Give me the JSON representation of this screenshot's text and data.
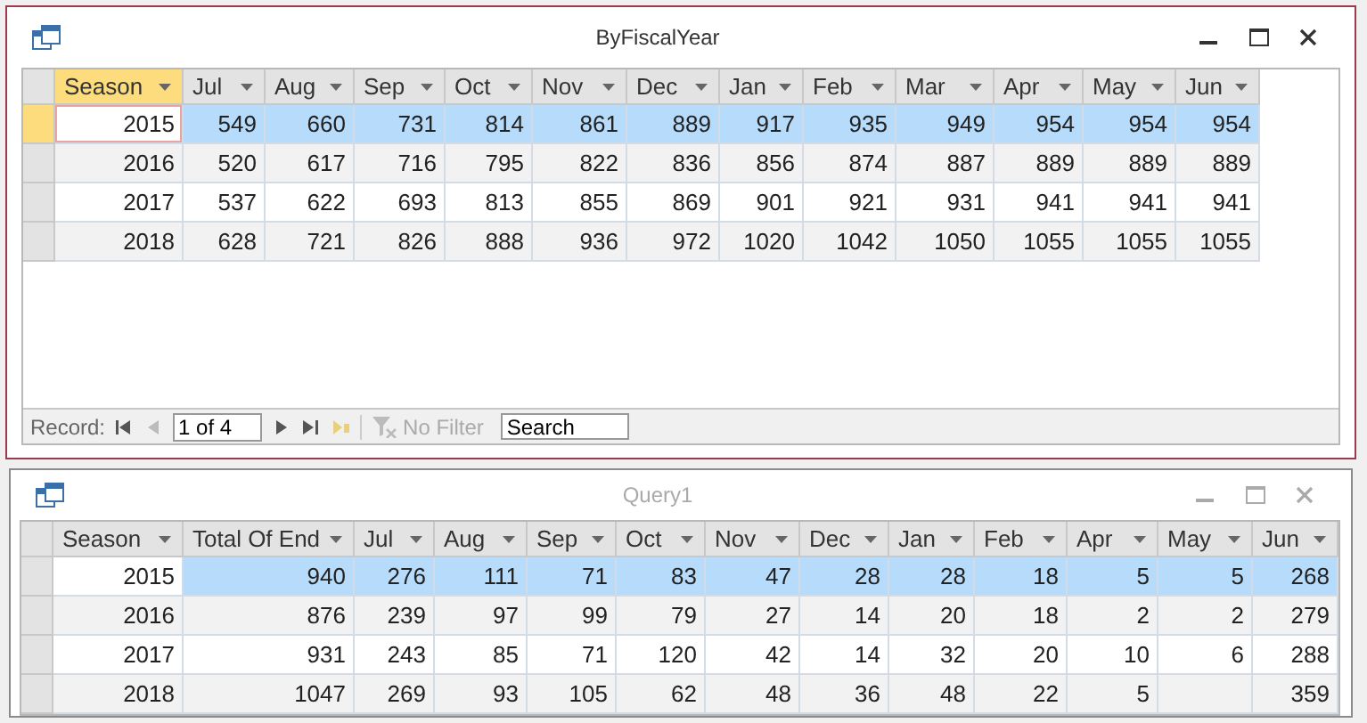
{
  "windows": [
    {
      "title": "ByFiscalYear",
      "active": true,
      "columns": [
        {
          "label": "Season",
          "selected": true
        },
        {
          "label": "Jul",
          "selected": false
        },
        {
          "label": "Aug",
          "selected": false
        },
        {
          "label": "Sep",
          "selected": false
        },
        {
          "label": "Oct",
          "selected": false
        },
        {
          "label": "Nov",
          "selected": false
        },
        {
          "label": "Dec",
          "selected": false
        },
        {
          "label": "Jan",
          "selected": false
        },
        {
          "label": "Feb",
          "selected": false
        },
        {
          "label": "Mar",
          "selected": false
        },
        {
          "label": "Apr",
          "selected": false
        },
        {
          "label": "May",
          "selected": false
        },
        {
          "label": "Jun",
          "selected": false
        }
      ],
      "rows": [
        {
          "selected": true,
          "cells": [
            "2015",
            "549",
            "660",
            "731",
            "814",
            "861",
            "889",
            "917",
            "935",
            "949",
            "954",
            "954",
            "954"
          ]
        },
        {
          "selected": false,
          "cells": [
            "2016",
            "520",
            "617",
            "716",
            "795",
            "822",
            "836",
            "856",
            "874",
            "887",
            "889",
            "889",
            "889"
          ]
        },
        {
          "selected": false,
          "cells": [
            "2017",
            "537",
            "622",
            "693",
            "813",
            "855",
            "869",
            "901",
            "921",
            "931",
            "941",
            "941",
            "941"
          ]
        },
        {
          "selected": false,
          "cells": [
            "2018",
            "628",
            "721",
            "826",
            "888",
            "936",
            "972",
            "1020",
            "1042",
            "1050",
            "1055",
            "1055",
            "1055"
          ]
        }
      ],
      "record_nav": {
        "label": "Record:",
        "position": "1 of 4",
        "filter": {
          "label": "No Filter",
          "disabled": true
        },
        "search": {
          "placeholder": "Search"
        }
      }
    },
    {
      "title": "Query1",
      "active": false,
      "columns": [
        {
          "label": "Season",
          "selected": false
        },
        {
          "label": "Total Of End",
          "selected": false
        },
        {
          "label": "Jul",
          "selected": false
        },
        {
          "label": "Aug",
          "selected": false
        },
        {
          "label": "Sep",
          "selected": false
        },
        {
          "label": "Oct",
          "selected": false
        },
        {
          "label": "Nov",
          "selected": false
        },
        {
          "label": "Dec",
          "selected": false
        },
        {
          "label": "Jan",
          "selected": false
        },
        {
          "label": "Feb",
          "selected": false
        },
        {
          "label": "Apr",
          "selected": false
        },
        {
          "label": "May",
          "selected": false
        },
        {
          "label": "Jun",
          "selected": false
        }
      ],
      "rows": [
        {
          "selected": true,
          "cells": [
            "2015",
            "940",
            "276",
            "111",
            "71",
            "83",
            "47",
            "28",
            "28",
            "18",
            "5",
            "5",
            "268"
          ]
        },
        {
          "selected": false,
          "cells": [
            "2016",
            "876",
            "239",
            "97",
            "99",
            "79",
            "27",
            "14",
            "20",
            "18",
            "2",
            "2",
            "279"
          ]
        },
        {
          "selected": false,
          "cells": [
            "2017",
            "931",
            "243",
            "85",
            "71",
            "120",
            "42",
            "14",
            "32",
            "20",
            "10",
            "6",
            "288"
          ]
        },
        {
          "selected": false,
          "cells": [
            "2018",
            "1047",
            "269",
            "93",
            "105",
            "62",
            "48",
            "36",
            "48",
            "22",
            "5",
            null,
            "359"
          ]
        }
      ]
    }
  ]
}
